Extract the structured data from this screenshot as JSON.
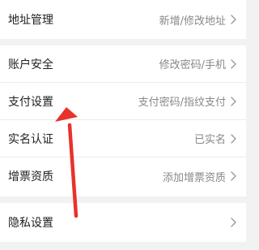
{
  "groups": [
    {
      "items": [
        {
          "label": "地址管理",
          "value": "新增/修改地址"
        }
      ]
    },
    {
      "items": [
        {
          "label": "账户安全",
          "value": "修改密码/手机"
        },
        {
          "label": "支付设置",
          "value": "支付密码/指纹支付"
        },
        {
          "label": "实名认证",
          "value": "已实名"
        },
        {
          "label": "增票资质",
          "value": "添加增票资质"
        }
      ]
    },
    {
      "items": [
        {
          "label": "隐私设置",
          "value": ""
        }
      ]
    }
  ],
  "colors": {
    "annotation_arrow": "#e8322a",
    "background": "#f2f2f2",
    "row_background": "#ffffff",
    "label_text": "#222222",
    "value_text": "#888888"
  },
  "icons": {
    "row_chevron": "chevron-right-icon",
    "annotation": "red-arrow-icon"
  }
}
